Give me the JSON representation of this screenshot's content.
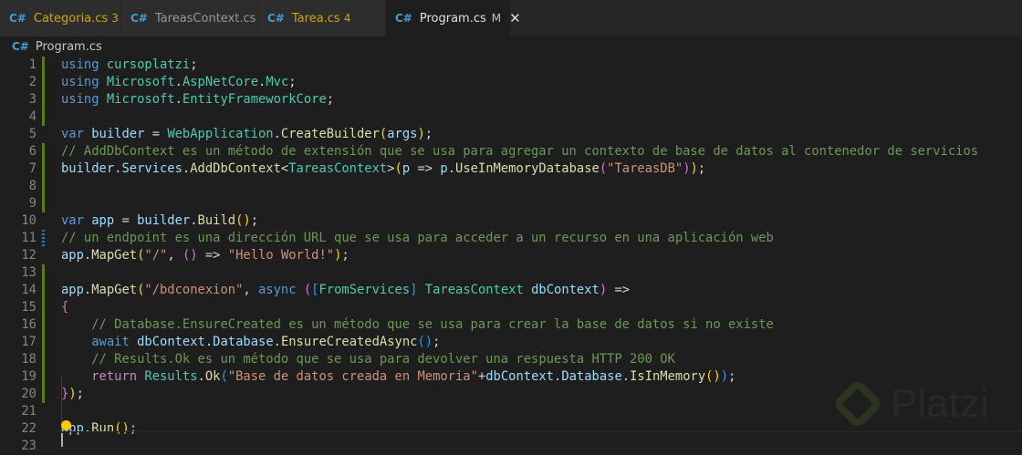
{
  "tabs": [
    {
      "icon": "C#",
      "label": "Categoria.cs",
      "badge": "3",
      "warn": true
    },
    {
      "icon": "C#",
      "label": "TareasContext.cs",
      "badge": "",
      "warn": false
    },
    {
      "icon": "C#",
      "label": "Tarea.cs",
      "badge": "4",
      "warn": true
    },
    {
      "icon": "C#",
      "label": "Program.cs",
      "badge": "M",
      "warn": false,
      "active": true,
      "close": "✕"
    }
  ],
  "breadcrumb": {
    "icon": "C#",
    "file": "Program.cs"
  },
  "watermark": "Platzi",
  "lines": [
    {
      "n": "1",
      "g": "add",
      "tokens": [
        [
          "using",
          "k"
        ],
        [
          " ",
          "p"
        ],
        [
          "cursoplatzi",
          "t"
        ],
        [
          ";",
          "p"
        ]
      ]
    },
    {
      "n": "2",
      "g": "add",
      "tokens": [
        [
          "using",
          "k"
        ],
        [
          " ",
          "p"
        ],
        [
          "Microsoft",
          "t"
        ],
        [
          ".",
          "p"
        ],
        [
          "AspNetCore",
          "t"
        ],
        [
          ".",
          "p"
        ],
        [
          "Mvc",
          "t"
        ],
        [
          ";",
          "p"
        ]
      ]
    },
    {
      "n": "3",
      "g": "add",
      "tokens": [
        [
          "using",
          "k"
        ],
        [
          " ",
          "p"
        ],
        [
          "Microsoft",
          "t"
        ],
        [
          ".",
          "p"
        ],
        [
          "EntityFrameworkCore",
          "t"
        ],
        [
          ";",
          "p"
        ]
      ]
    },
    {
      "n": "4",
      "g": "add",
      "tokens": []
    },
    {
      "n": "5",
      "g": "",
      "tokens": [
        [
          "var",
          "k"
        ],
        [
          " ",
          "p"
        ],
        [
          "builder",
          "v"
        ],
        [
          " = ",
          "p"
        ],
        [
          "WebApplication",
          "t"
        ],
        [
          ".",
          "p"
        ],
        [
          "CreateBuilder",
          "f"
        ],
        [
          "(",
          "y"
        ],
        [
          "args",
          "v"
        ],
        [
          ")",
          "y"
        ],
        [
          ";",
          "p"
        ]
      ]
    },
    {
      "n": "6",
      "g": "add",
      "tokens": [
        [
          "// AddDbContext es un método de extensión que se usa para agregar un contexto de base de datos al contenedor de servicios",
          "c"
        ]
      ]
    },
    {
      "n": "7",
      "g": "add",
      "tokens": [
        [
          "builder",
          "v"
        ],
        [
          ".",
          "p"
        ],
        [
          "Services",
          "v"
        ],
        [
          ".",
          "p"
        ],
        [
          "AddDbContext",
          "f"
        ],
        [
          "<",
          "p"
        ],
        [
          "TareasContext",
          "t"
        ],
        [
          ">",
          "p"
        ],
        [
          "(",
          "y"
        ],
        [
          "p",
          "v"
        ],
        [
          " => ",
          "p"
        ],
        [
          "p",
          "v"
        ],
        [
          ".",
          "p"
        ],
        [
          "UseInMemoryDatabase",
          "f"
        ],
        [
          "(",
          "m"
        ],
        [
          "\"TareasDB\"",
          "s"
        ],
        [
          ")",
          "m"
        ],
        [
          ")",
          "y"
        ],
        [
          ";",
          "p"
        ]
      ]
    },
    {
      "n": "8",
      "g": "add",
      "tokens": []
    },
    {
      "n": "9",
      "g": "add",
      "tokens": []
    },
    {
      "n": "10",
      "g": "",
      "tokens": [
        [
          "var",
          "k"
        ],
        [
          " ",
          "p"
        ],
        [
          "app",
          "v"
        ],
        [
          " = ",
          "p"
        ],
        [
          "builder",
          "v"
        ],
        [
          ".",
          "p"
        ],
        [
          "Build",
          "f"
        ],
        [
          "()",
          "y"
        ],
        [
          ";",
          "p"
        ]
      ]
    },
    {
      "n": "11",
      "g": "mod",
      "tokens": [
        [
          "// un endpoint es una dirección URL que se usa para acceder a un recurso en una aplicación web",
          "c"
        ]
      ]
    },
    {
      "n": "12",
      "g": "",
      "tokens": [
        [
          "app",
          "v"
        ],
        [
          ".",
          "p"
        ],
        [
          "MapGet",
          "f"
        ],
        [
          "(",
          "y"
        ],
        [
          "\"/\"",
          "s"
        ],
        [
          ", ",
          "p"
        ],
        [
          "()",
          "m"
        ],
        [
          " => ",
          "p"
        ],
        [
          "\"Hello World!\"",
          "s"
        ],
        [
          ")",
          "y"
        ],
        [
          ";",
          "p"
        ]
      ]
    },
    {
      "n": "13",
      "g": "add",
      "tokens": []
    },
    {
      "n": "14",
      "g": "add",
      "tokens": [
        [
          "app",
          "v"
        ],
        [
          ".",
          "p"
        ],
        [
          "MapGet",
          "f"
        ],
        [
          "(",
          "y"
        ],
        [
          "\"/bdconexion\"",
          "s"
        ],
        [
          ", ",
          "p"
        ],
        [
          "async",
          "k"
        ],
        [
          " ",
          "p"
        ],
        [
          "(",
          "m"
        ],
        [
          "[",
          "b"
        ],
        [
          "FromServices",
          "t"
        ],
        [
          "]",
          "b"
        ],
        [
          " ",
          "p"
        ],
        [
          "TareasContext",
          "t"
        ],
        [
          " ",
          "p"
        ],
        [
          "dbContext",
          "v"
        ],
        [
          ")",
          "m"
        ],
        [
          " =>",
          "p"
        ]
      ]
    },
    {
      "n": "15",
      "g": "add",
      "tokens": [
        [
          "{",
          "m"
        ]
      ]
    },
    {
      "n": "16",
      "g": "add",
      "tokens": [
        [
          "    ",
          "p"
        ],
        [
          "// Database.EnsureCreated es un método que se usa para crear la base de datos si no existe",
          "c"
        ]
      ]
    },
    {
      "n": "17",
      "g": "add",
      "tokens": [
        [
          "    ",
          "p"
        ],
        [
          "await",
          "k"
        ],
        [
          " ",
          "p"
        ],
        [
          "dbContext",
          "v"
        ],
        [
          ".",
          "p"
        ],
        [
          "Database",
          "v"
        ],
        [
          ".",
          "p"
        ],
        [
          "EnsureCreatedAsync",
          "f"
        ],
        [
          "()",
          "b"
        ],
        [
          ";",
          "p"
        ]
      ]
    },
    {
      "n": "18",
      "g": "add",
      "tokens": [
        [
          "    ",
          "p"
        ],
        [
          "// Results.Ok es un método que se usa para devolver una respuesta HTTP 200 OK",
          "c"
        ]
      ]
    },
    {
      "n": "19",
      "g": "add",
      "tokens": [
        [
          "    ",
          "p"
        ],
        [
          "return",
          "r"
        ],
        [
          " ",
          "p"
        ],
        [
          "Results",
          "t"
        ],
        [
          ".",
          "p"
        ],
        [
          "Ok",
          "f"
        ],
        [
          "(",
          "b"
        ],
        [
          "\"Base de datos creada en Memoria\"",
          "s"
        ],
        [
          "+",
          "p"
        ],
        [
          "dbContext",
          "v"
        ],
        [
          ".",
          "p"
        ],
        [
          "Database",
          "v"
        ],
        [
          ".",
          "p"
        ],
        [
          "IsInMemory",
          "f"
        ],
        [
          "()",
          "y"
        ],
        [
          ")",
          "b"
        ],
        [
          ";",
          "p"
        ]
      ]
    },
    {
      "n": "20",
      "g": "add",
      "tokens": [
        [
          "}",
          "m"
        ],
        [
          ")",
          "y"
        ],
        [
          ";",
          "p"
        ]
      ]
    },
    {
      "n": "21",
      "g": "",
      "tokens": []
    },
    {
      "n": "22",
      "g": "",
      "tokens": [
        [
          "app",
          "v"
        ],
        [
          ".",
          "p"
        ],
        [
          "Run",
          "f"
        ],
        [
          "()",
          "y"
        ],
        [
          ";",
          "p"
        ]
      ]
    },
    {
      "n": "23",
      "g": "",
      "tokens": []
    }
  ]
}
